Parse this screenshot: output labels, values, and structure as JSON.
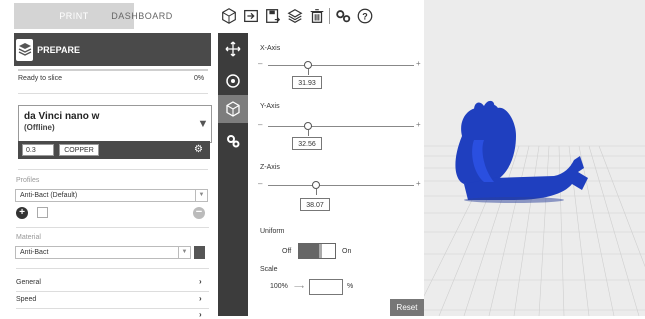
{
  "tabs": {
    "print": "PRINT",
    "dashboard": "DASHBOARD"
  },
  "toolbar": {
    "icons": [
      "box-add-icon",
      "import-icon",
      "save-icon",
      "layers-icon",
      "trash-icon",
      "gears-icon",
      "help-icon"
    ]
  },
  "prepare": {
    "label": "PREPARE"
  },
  "status": {
    "text": "Ready to slice",
    "percent": "0%",
    "progress": 0
  },
  "printer": {
    "name": "da Vinci nano w",
    "status": "(Offline)",
    "nozzle": "0.3",
    "material": "COPPER"
  },
  "profiles": {
    "label": "Profiles",
    "selected": "Anti-Bact (Default)"
  },
  "material": {
    "label": "Material",
    "selected": "Anti-Bact",
    "swatch_color": "#555555"
  },
  "settings": {
    "general": "General",
    "speed": "Speed"
  },
  "scale": {
    "x_label": "X-Axis",
    "x_value": "31.93",
    "y_label": "Y-Axis",
    "y_value": "32.56",
    "z_label": "Z-Axis",
    "z_value": "38.07",
    "uniform_label": "Uniform",
    "off_label": "Off",
    "on_label": "On",
    "scale_label": "Scale",
    "scale_from": "100%",
    "scale_unit": "%",
    "reset_label": "Reset",
    "minus": "–",
    "plus": "+"
  },
  "colors": {
    "model": "#1f3fbf",
    "dark_bar": "#4a4a4a",
    "strip": "#3c3c3c"
  }
}
